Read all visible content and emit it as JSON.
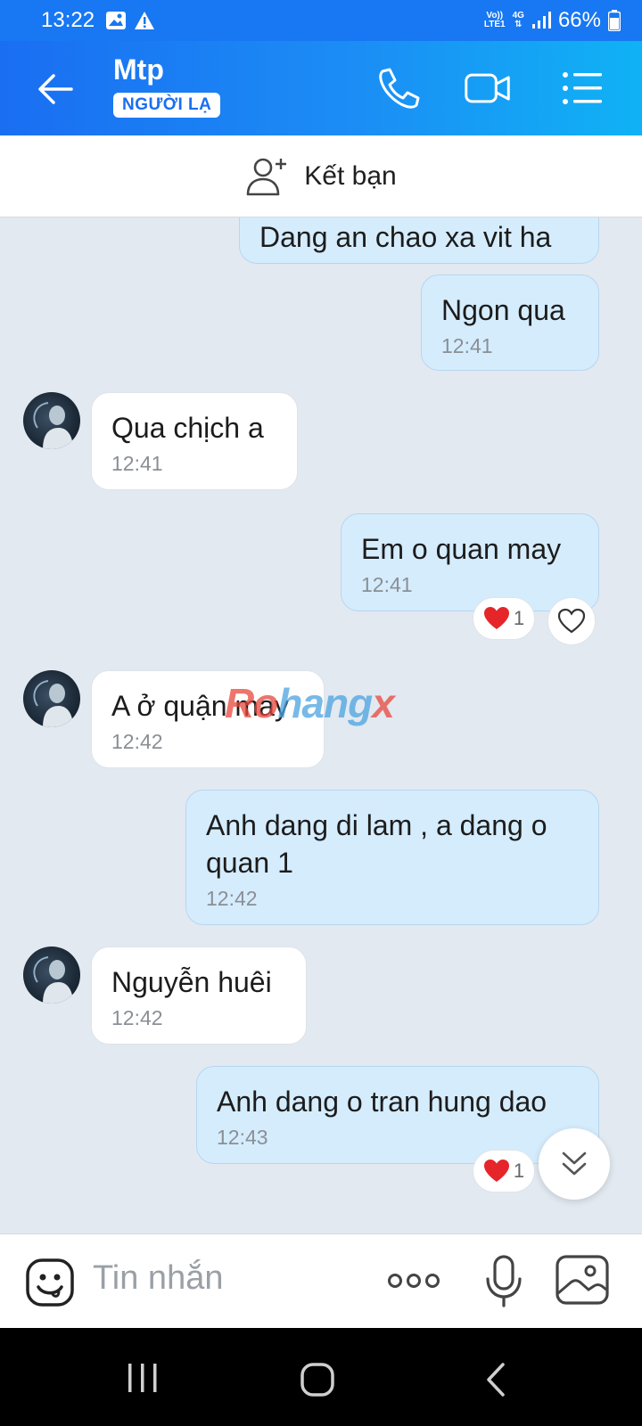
{
  "status_bar": {
    "time": "13:22",
    "network_top": "Vo))",
    "network_bottom": "LTE1",
    "signal_type": "4G",
    "battery": "66%"
  },
  "header": {
    "contact_name": "Mtp",
    "badge": "NGƯỜI LẠ",
    "icons": [
      "back-arrow-icon",
      "phone-icon",
      "video-icon",
      "menu-icon"
    ]
  },
  "friend_bar": {
    "label": "Kết bạn"
  },
  "messages": [
    {
      "dir": "out",
      "text": "Dang an chao xa vit ha",
      "time": ""
    },
    {
      "dir": "out",
      "text": "Ngon qua",
      "time": "12:41"
    },
    {
      "dir": "in",
      "text": "Qua chịch a",
      "time": "12:41"
    },
    {
      "dir": "out",
      "text": "Em o quan may",
      "time": "12:41",
      "reaction_count": "1"
    },
    {
      "dir": "in",
      "text": "A ở quận may",
      "time": "12:42"
    },
    {
      "dir": "out",
      "text": "Anh dang di lam , a dang o quan 1",
      "time": "12:42"
    },
    {
      "dir": "in",
      "text": "Nguyễn huêi",
      "time": "12:42"
    },
    {
      "dir": "out",
      "text": "Anh dang o tran hung dao",
      "time": "12:43",
      "reaction_count": "1"
    }
  ],
  "watermark": {
    "part1": "Ro",
    "part2": "hang",
    "part3": "x"
  },
  "composer": {
    "placeholder": "Tin nhắn"
  },
  "colors": {
    "header": "#1877f2",
    "out_bubble": "#d5ecfd",
    "in_bubble": "#ffffff",
    "chat_bg": "#e2e9f1"
  }
}
